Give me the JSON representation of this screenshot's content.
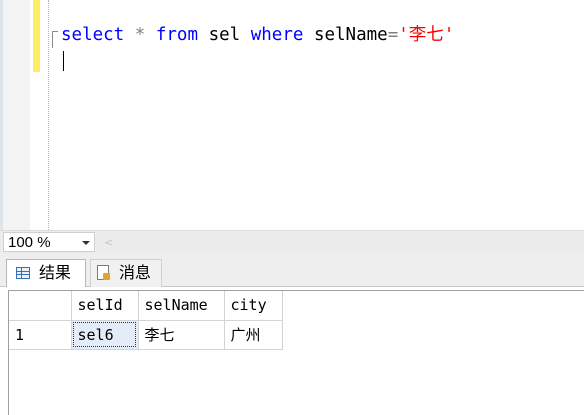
{
  "editor": {
    "query": {
      "kw_select": "select",
      "star": "*",
      "kw_from": "from",
      "table": "sel",
      "kw_where": "where",
      "column": "selName",
      "equals": "=",
      "string": "'李七'"
    }
  },
  "zoom": {
    "value": "100 %",
    "scroll_left_glyph": "<"
  },
  "tabs": [
    {
      "label": "结果",
      "icon": "results-grid-icon"
    },
    {
      "label": "消息",
      "icon": "messages-icon"
    }
  ],
  "results": {
    "columns": [
      "selId",
      "selName",
      "city"
    ],
    "rows": [
      {
        "rownum": "1",
        "cells": [
          "sel6",
          "李七",
          "广州"
        ]
      }
    ]
  }
}
